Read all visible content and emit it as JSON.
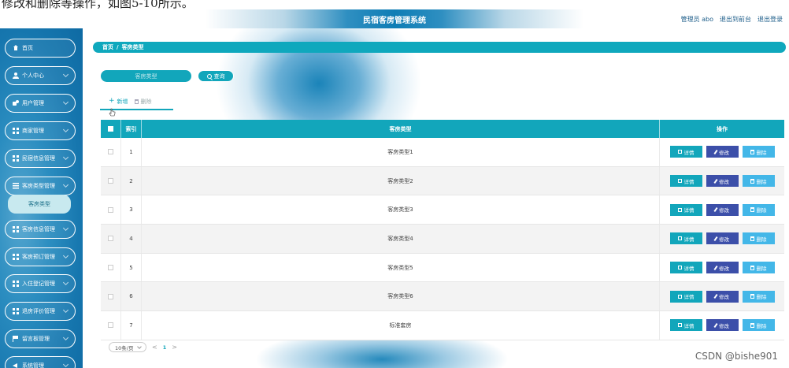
{
  "caption": "修改和删除等操作，如图5-10所示。",
  "header": {
    "title": "民宿客房管理系统",
    "user": "管理员 abo",
    "links": [
      "退出到前台",
      "退出登录"
    ]
  },
  "sidebar": {
    "items": [
      {
        "label": "首页",
        "icon": "home-icon"
      },
      {
        "label": "个人中心",
        "icon": "user-icon"
      },
      {
        "label": "用户管理",
        "icon": "admin-icon"
      },
      {
        "label": "商家管理",
        "icon": "grid-icon"
      },
      {
        "label": "民宿信息管理",
        "icon": "grid-icon"
      },
      {
        "label": "客房类型管理",
        "icon": "list-icon",
        "sub": "客房类型"
      },
      {
        "label": "客房信息管理",
        "icon": "grid-icon"
      },
      {
        "label": "客房预订管理",
        "icon": "grid-icon"
      },
      {
        "label": "入住登记管理",
        "icon": "grid-icon"
      },
      {
        "label": "退房评价管理",
        "icon": "grid-icon"
      },
      {
        "label": "留言板管理",
        "icon": "flag-icon"
      },
      {
        "label": "系统管理",
        "icon": "arrow-icon"
      }
    ]
  },
  "breadcrumb": {
    "home": "首页",
    "sep": "/",
    "current": "客房类型"
  },
  "search": {
    "placeholder": "客房类型",
    "button": "查询"
  },
  "toolbar": {
    "add": "新增",
    "delete": "删除"
  },
  "table": {
    "columns": {
      "index": "索引",
      "type": "客房类型",
      "ops": "操作"
    },
    "rows": [
      {
        "index": "1",
        "type": "客房类型1"
      },
      {
        "index": "2",
        "type": "客房类型2"
      },
      {
        "index": "3",
        "type": "客房类型3"
      },
      {
        "index": "4",
        "type": "客房类型4"
      },
      {
        "index": "5",
        "type": "客房类型5"
      },
      {
        "index": "6",
        "type": "客房类型6"
      },
      {
        "index": "7",
        "type": "标准套房"
      }
    ],
    "actions": {
      "detail": "详情",
      "edit": "修改",
      "delete": "删除"
    }
  },
  "pager": {
    "page_size": "10条/页",
    "current_page": "1",
    "prev": "<",
    "next": ">"
  },
  "watermark": "CSDN @bishe901",
  "colors": {
    "accent": "#12a6bb",
    "edit": "#3c4fa9",
    "delete": "#43b7e8",
    "sidebar": "#1676ae"
  }
}
